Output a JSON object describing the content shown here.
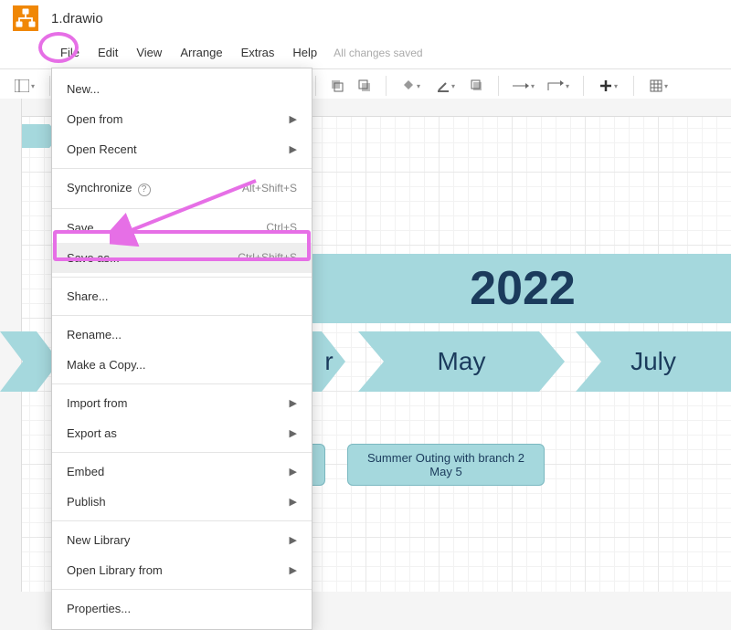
{
  "titlebar": {
    "filename": "1.drawio"
  },
  "menubar": {
    "items": [
      "File",
      "Edit",
      "View",
      "Arrange",
      "Extras",
      "Help"
    ],
    "status": "All changes saved"
  },
  "dropdown": {
    "groups": [
      [
        {
          "label": "New...",
          "shortcut": "",
          "submenu": false,
          "highlighted": false
        },
        {
          "label": "Open from",
          "shortcut": "",
          "submenu": true,
          "highlighted": false
        },
        {
          "label": "Open Recent",
          "shortcut": "",
          "submenu": true,
          "highlighted": false
        }
      ],
      [
        {
          "label": "Synchronize",
          "shortcut": "Alt+Shift+S",
          "submenu": false,
          "highlighted": false,
          "help": true
        }
      ],
      [
        {
          "label": "Save",
          "shortcut": "Ctrl+S",
          "submenu": false,
          "highlighted": false
        },
        {
          "label": "Save as...",
          "shortcut": "Ctrl+Shift+S",
          "submenu": false,
          "highlighted": true
        }
      ],
      [
        {
          "label": "Share...",
          "shortcut": "",
          "submenu": false,
          "highlighted": false
        }
      ],
      [
        {
          "label": "Rename...",
          "shortcut": "",
          "submenu": false,
          "highlighted": false
        },
        {
          "label": "Make a Copy...",
          "shortcut": "",
          "submenu": false,
          "highlighted": false
        }
      ],
      [
        {
          "label": "Import from",
          "shortcut": "",
          "submenu": true,
          "highlighted": false
        },
        {
          "label": "Export as",
          "shortcut": "",
          "submenu": true,
          "highlighted": false
        }
      ],
      [
        {
          "label": "Embed",
          "shortcut": "",
          "submenu": true,
          "highlighted": false
        },
        {
          "label": "Publish",
          "shortcut": "",
          "submenu": true,
          "highlighted": false
        }
      ],
      [
        {
          "label": "New Library",
          "shortcut": "",
          "submenu": true,
          "highlighted": false
        },
        {
          "label": "Open Library from",
          "shortcut": "",
          "submenu": true,
          "highlighted": false
        }
      ],
      [
        {
          "label": "Properties...",
          "shortcut": "",
          "submenu": false,
          "highlighted": false
        }
      ]
    ]
  },
  "diagram": {
    "year": "2022",
    "chevrons": [
      {
        "label_suffix": "r"
      },
      {
        "label": "May"
      },
      {
        "label": "July"
      }
    ],
    "note": {
      "line1": "Summer Outing with branch 2",
      "line2": "May 5"
    }
  },
  "toolbar_icons": [
    "view-grid",
    "zoom",
    "undo",
    "redo",
    "delete",
    "front",
    "back",
    "fill",
    "stroke",
    "shadow",
    "connection",
    "waypoint",
    "add",
    "table"
  ]
}
